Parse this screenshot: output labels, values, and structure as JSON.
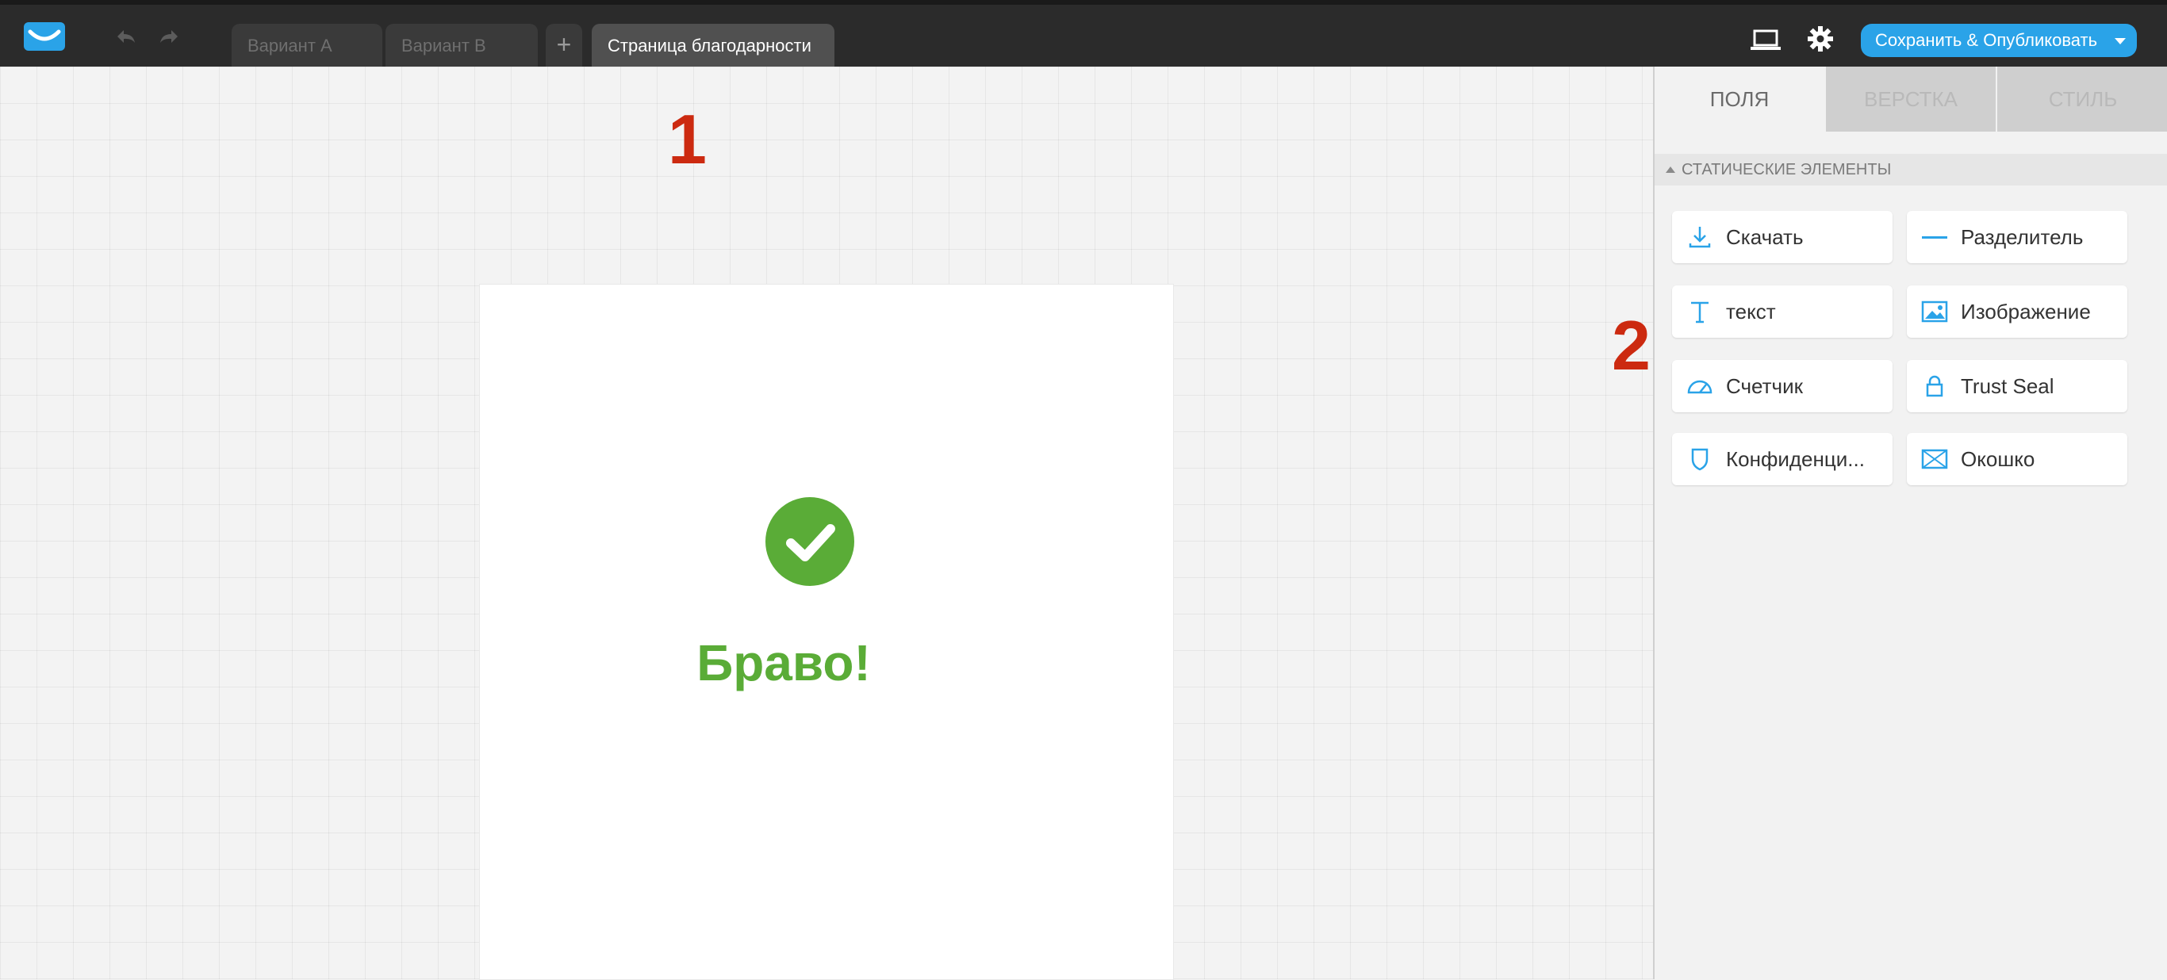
{
  "toolbar": {
    "tabs": [
      {
        "label": "Вариант A"
      },
      {
        "label": "Вариант B"
      },
      {
        "label": "+"
      },
      {
        "label": "Страница благодарности"
      }
    ],
    "publish_label": "Сохранить & Опубликовать"
  },
  "annotations": [
    "1",
    "2"
  ],
  "canvas": {
    "heading": "Браво!"
  },
  "panel": {
    "tabs": [
      {
        "label": "ПОЛЯ"
      },
      {
        "label": "ВЕРСТКА"
      },
      {
        "label": "СТИЛЬ"
      }
    ],
    "section_title": "СТАТИЧЕСКИЕ ЭЛЕМЕНТЫ",
    "elements": [
      {
        "label": "Скачать",
        "icon": "download-icon"
      },
      {
        "label": "Разделитель",
        "icon": "divider-icon"
      },
      {
        "label": "текст",
        "icon": "text-icon"
      },
      {
        "label": "Изображение",
        "icon": "image-icon"
      },
      {
        "label": "Счетчик",
        "icon": "gauge-icon"
      },
      {
        "label": "Trust Seal",
        "icon": "lock-icon"
      },
      {
        "label": "Конфиденци...",
        "icon": "shield-icon"
      },
      {
        "label": "Окошко",
        "icon": "envelope-icon"
      }
    ]
  },
  "colors": {
    "accent": "#2aa3e8",
    "success": "#5aac37",
    "annotation": "#cc2a10",
    "topbar": "#2b2b2b"
  }
}
